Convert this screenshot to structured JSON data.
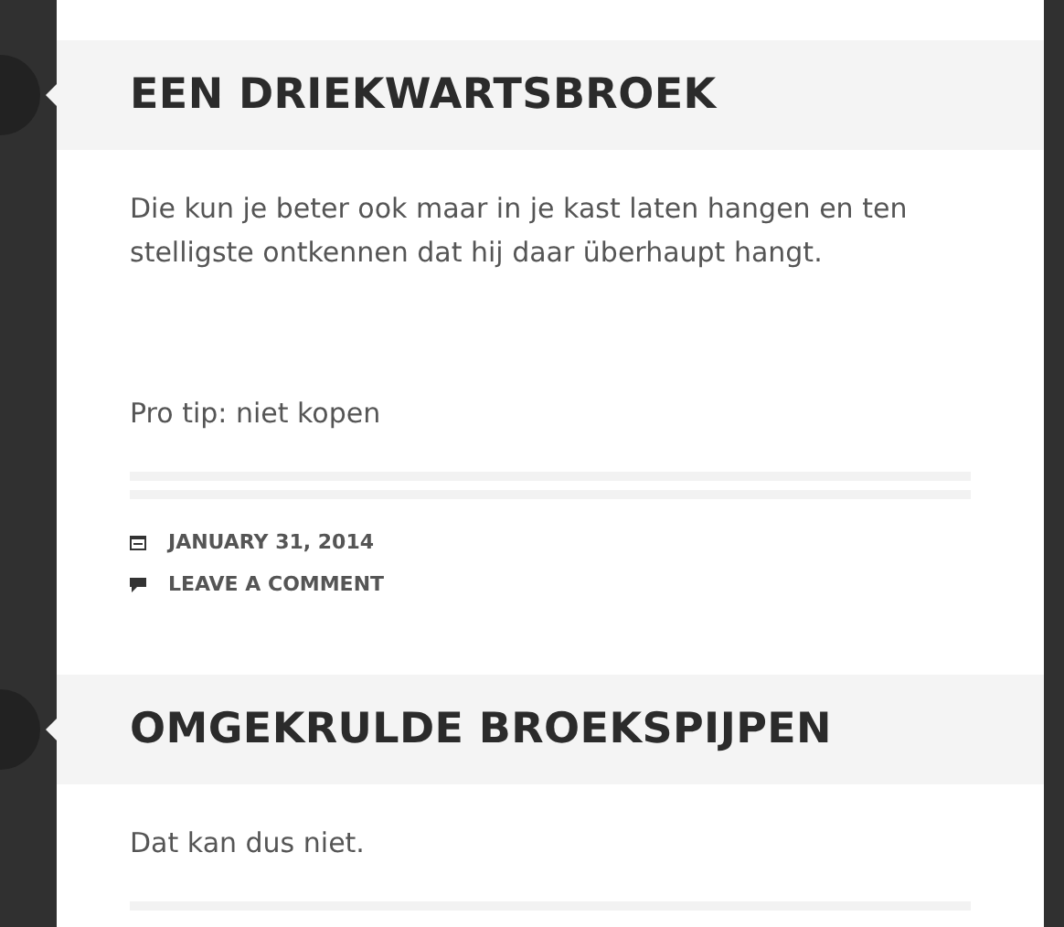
{
  "posts": [
    {
      "title": "EEN DRIEKWARTSBROEK",
      "paragraphs": [
        "Die kun je beter ook maar in je kast laten hangen en ten stelligste ontkennen dat hij daar überhaupt hangt.",
        "Pro tip: niet kopen"
      ],
      "meta": [
        {
          "kind": "date",
          "text": "JANUARY 31, 2014"
        },
        {
          "kind": "comment",
          "text": "LEAVE A COMMENT"
        }
      ]
    },
    {
      "title": "OMGEKRULDE BROEKSPIJPEN",
      "paragraphs": [
        "Dat kan dus niet."
      ]
    }
  ]
}
